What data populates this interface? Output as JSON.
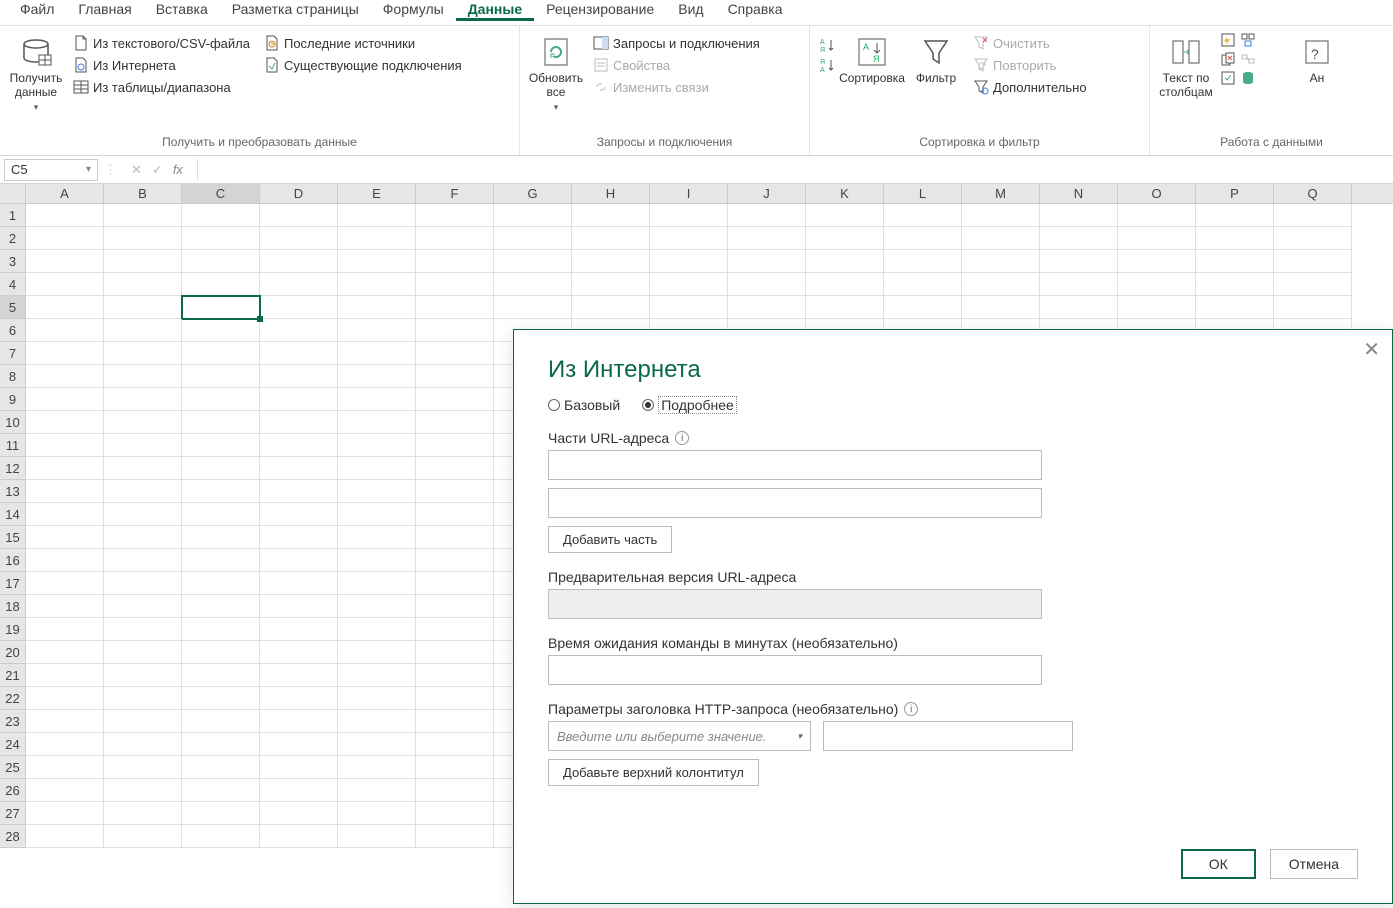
{
  "menu_tabs": [
    "Файл",
    "Главная",
    "Вставка",
    "Разметка страницы",
    "Формулы",
    "Данные",
    "Рецензирование",
    "Вид",
    "Справка"
  ],
  "active_tab_index": 5,
  "ribbon": {
    "group1": {
      "title": "Получить и преобразовать данные",
      "get_data": "Получить\nданные",
      "from_csv": "Из текстового/CSV-файла",
      "from_web": "Из Интернета",
      "from_table": "Из таблицы/диапазона",
      "recent": "Последние источники",
      "existing": "Существующие подключения"
    },
    "group2": {
      "title": "Запросы и подключения",
      "refresh": "Обновить\nвсе",
      "queries": "Запросы и подключения",
      "props": "Свойства",
      "links": "Изменить связи"
    },
    "group3": {
      "title": "Сортировка и фильтр",
      "sort": "Сортировка",
      "filter": "Фильтр",
      "clear": "Очистить",
      "reapply": "Повторить",
      "advanced": "Дополнительно"
    },
    "group4": {
      "title": "Работа с данными",
      "text_cols": "Текст по\nстолбцам",
      "analysis": "Ан"
    }
  },
  "name_box": "C5",
  "columns": [
    "A",
    "B",
    "C",
    "D",
    "E",
    "F",
    "G",
    "H",
    "I",
    "J",
    "K",
    "L",
    "M",
    "N",
    "O",
    "P",
    "Q"
  ],
  "rows": [
    "1",
    "2",
    "3",
    "4",
    "5",
    "6",
    "7",
    "8",
    "9",
    "10",
    "11",
    "12",
    "13",
    "14",
    "15",
    "16",
    "17",
    "18",
    "19",
    "20",
    "21",
    "22",
    "23",
    "24",
    "25",
    "26",
    "27",
    "28"
  ],
  "selected_row": 4,
  "selected_col": 2,
  "dialog": {
    "title": "Из Интернета",
    "opt_basic": "Базовый",
    "opt_advanced": "Подробнее",
    "url_parts_label": "Части URL-адреса",
    "add_part": "Добавить часть",
    "preview_label": "Предварительная версия URL-адреса",
    "timeout_label": "Время ожидания команды в минутах (необязательно)",
    "headers_label": "Параметры заголовка HTTP-запроса (необязательно)",
    "header_placeholder": "Введите или выберите значение.",
    "add_header": "Добавьте верхний колонтитул",
    "ok": "ОК",
    "cancel": "Отмена"
  }
}
